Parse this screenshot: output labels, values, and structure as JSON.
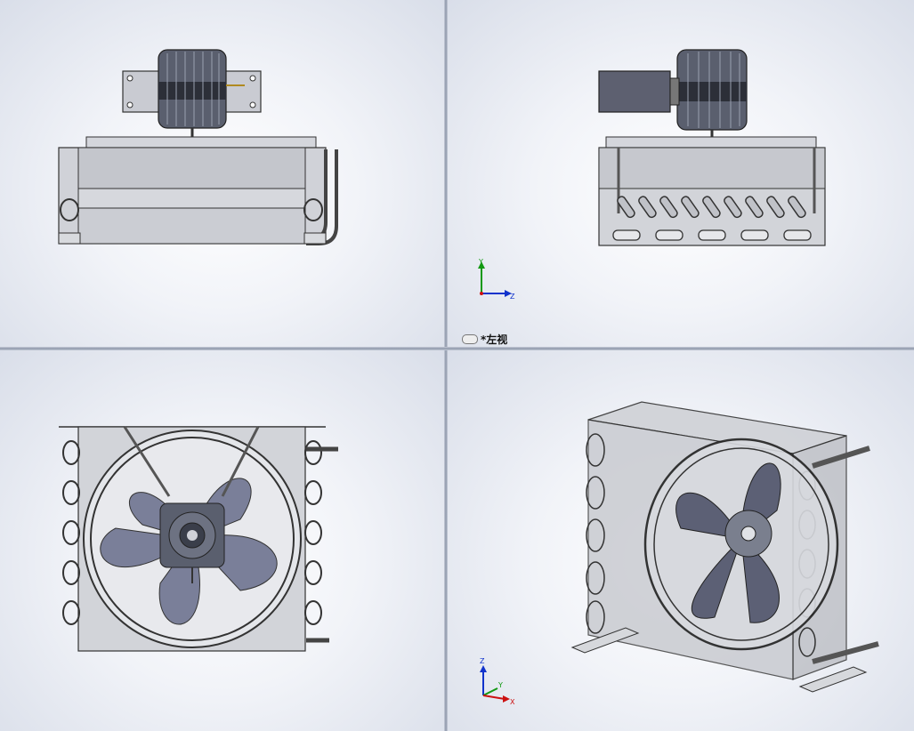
{
  "viewports": {
    "front": {
      "name": "front"
    },
    "left": {
      "name": "left",
      "label_icon": "link-icon",
      "label": "*左视"
    },
    "top": {
      "name": "top"
    },
    "iso": {
      "name": "isometric"
    }
  },
  "triad_left": {
    "axes": [
      "Y",
      "Z"
    ]
  },
  "triad_iso": {
    "axes": [
      "Z",
      "Y",
      "X"
    ]
  },
  "colors": {
    "viewport_bg": "#f1f3f8",
    "housing": "#c8cacf",
    "motor": "#4a4f5e",
    "blade": "#7a7f99",
    "axis_x": "#cc1111",
    "axis_y": "#119911",
    "axis_z": "#1133cc"
  }
}
